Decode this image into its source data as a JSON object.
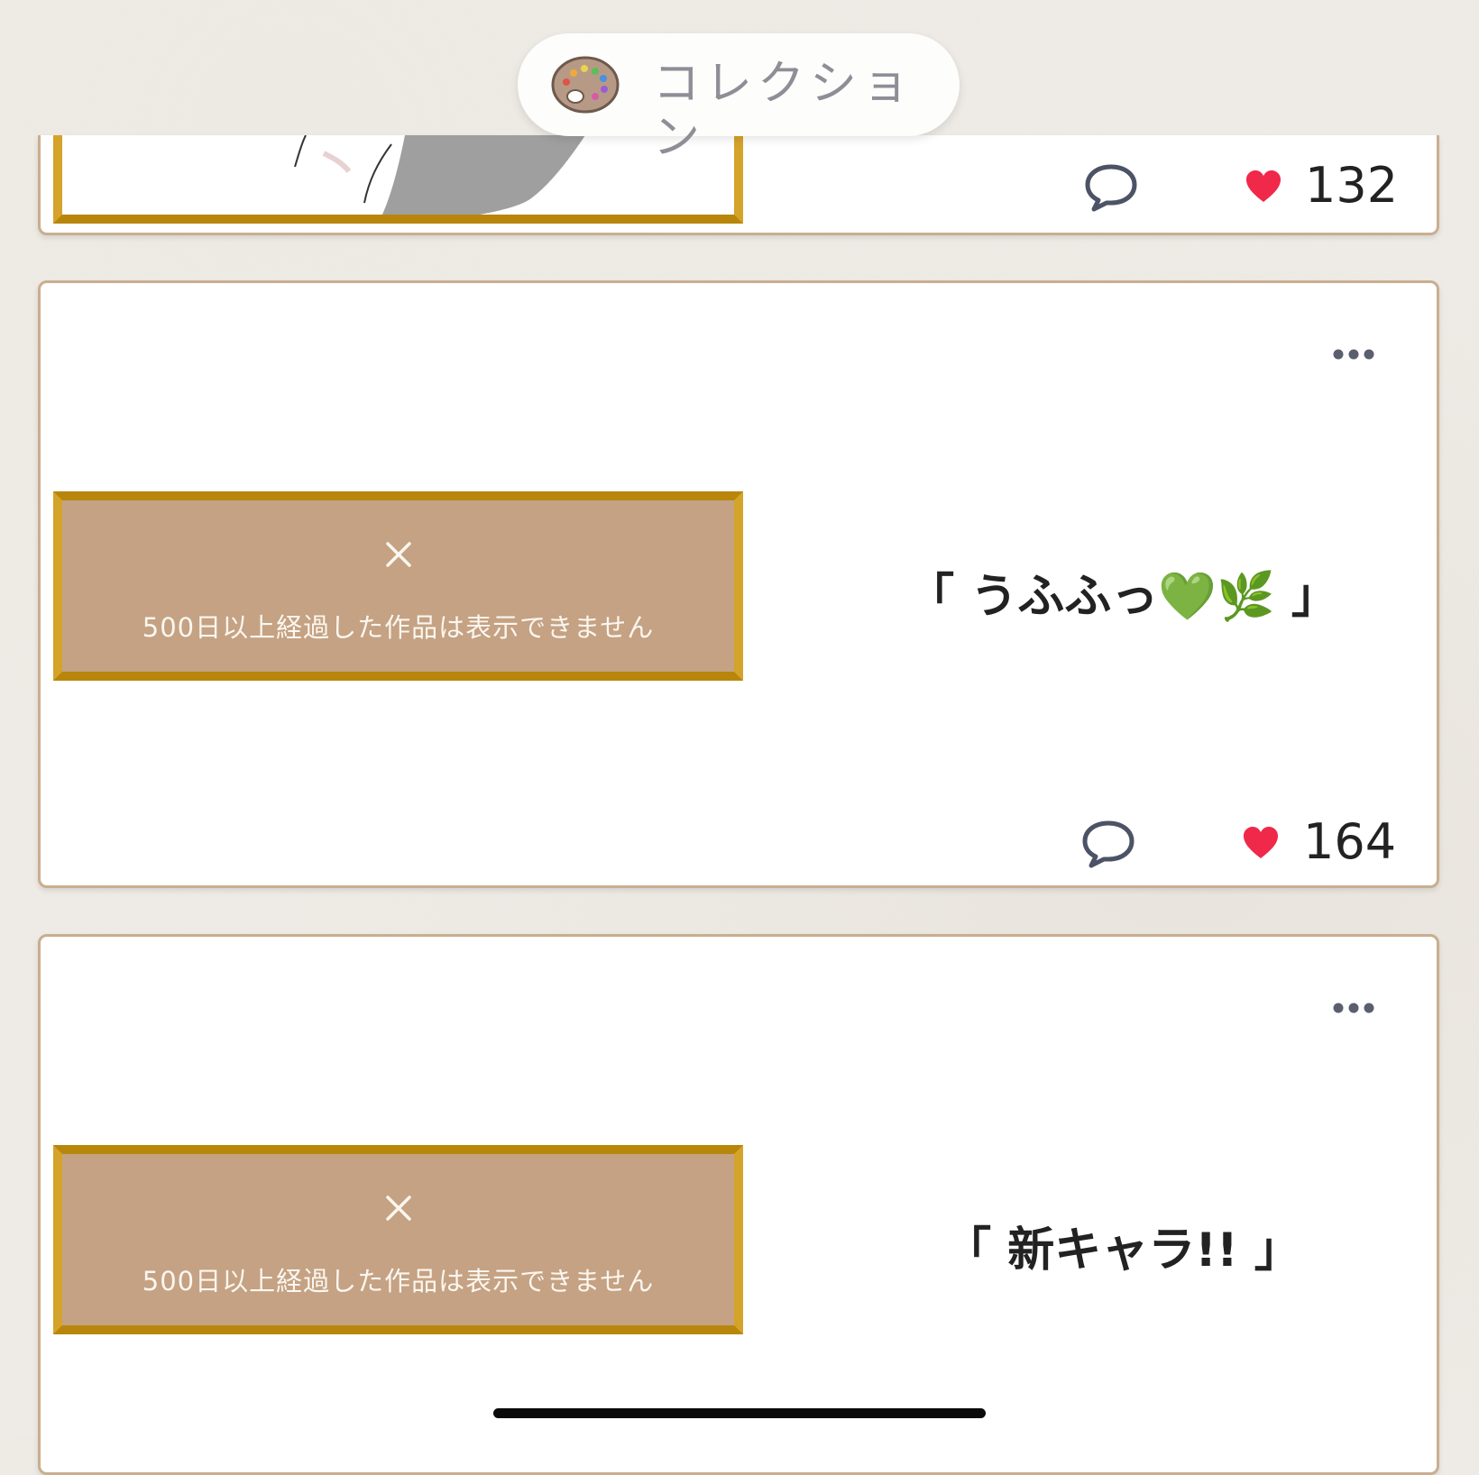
{
  "header": {
    "title": "コレクション",
    "icon": "palette-icon"
  },
  "posts": [
    {
      "title": "",
      "likes": "132",
      "image_state": "partial-artwork"
    },
    {
      "title": "「 うふふっ💚🌿 」",
      "blocked_message": "500日以上経過した作品は表示できません",
      "likes": "164"
    },
    {
      "title": "「 新キャラ!! 」",
      "blocked_message": "500日以上経過した作品は表示できません"
    }
  ],
  "colors": {
    "frame_gold": "#b8860b",
    "blocked_fill": "#c4a283",
    "heart": "#f0284a",
    "card_border": "#c9ae8f"
  }
}
